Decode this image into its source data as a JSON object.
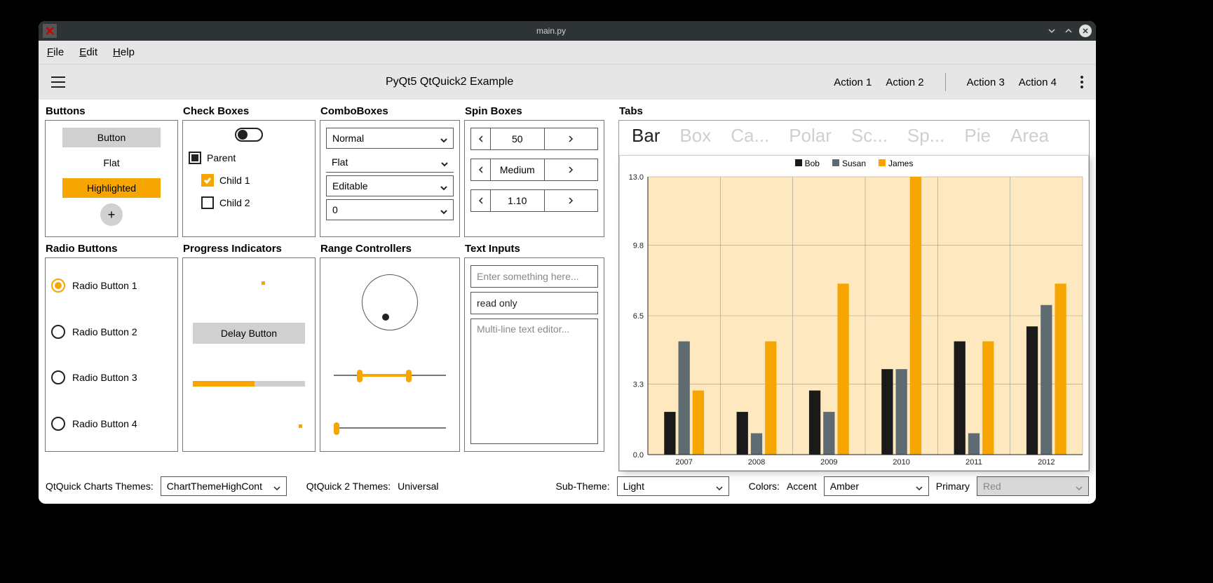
{
  "window": {
    "title": "main.py"
  },
  "menubar": {
    "file": "File",
    "edit": "Edit",
    "help": "Help"
  },
  "toolbar": {
    "app_title": "PyQt5 QtQuick2 Example",
    "action1": "Action 1",
    "action2": "Action 2",
    "action3": "Action 3",
    "action4": "Action 4"
  },
  "sections": {
    "buttons": "Buttons",
    "checkboxes": "Check Boxes",
    "combos": "ComboBoxes",
    "spins": "Spin Boxes",
    "tabs": "Tabs",
    "radios": "Radio Buttons",
    "progress": "Progress Indicators",
    "range": "Range Controllers",
    "text": "Text Inputs"
  },
  "buttons": {
    "button": "Button",
    "flat": "Flat",
    "highlighted": "Highlighted",
    "plus": "+"
  },
  "checkboxes": {
    "parent": "Parent",
    "child1": "Child 1",
    "child2": "Child 2"
  },
  "combos": {
    "normal": "Normal",
    "flat": "Flat",
    "editable": "Editable",
    "zero": "0"
  },
  "spins": {
    "s1": "50",
    "s2": "Medium",
    "s3": "1.10"
  },
  "radios": {
    "r1": "Radio Button 1",
    "r2": "Radio Button 2",
    "r3": "Radio Button 3",
    "r4": "Radio Button 4"
  },
  "progress": {
    "delay": "Delay Button"
  },
  "text_inputs": {
    "placeholder": "Enter something here...",
    "readonly": "read only",
    "multiline": "Multi-line text editor..."
  },
  "tabs": {
    "items": [
      "Bar",
      "Box",
      "Ca...",
      "Polar",
      "Sc...",
      "Sp...",
      "Pie",
      "Area"
    ],
    "active": 0
  },
  "chart_data": {
    "type": "bar",
    "title": "",
    "xlabel": "",
    "ylabel": "",
    "categories": [
      "2007",
      "2008",
      "2009",
      "2010",
      "2011",
      "2012"
    ],
    "series": [
      {
        "name": "Bob",
        "color": "#1a1a1a",
        "values": [
          2.0,
          2.0,
          3.0,
          4.0,
          5.3,
          6.0
        ]
      },
      {
        "name": "Susan",
        "color": "#5f6b73",
        "values": [
          5.3,
          1.0,
          2.0,
          4.0,
          1.0,
          7.0
        ]
      },
      {
        "name": "James",
        "color": "#f7a500",
        "values": [
          3.0,
          5.3,
          8.0,
          13.0,
          5.3,
          8.0
        ]
      }
    ],
    "ylim": [
      0,
      13
    ],
    "yticks": [
      0.0,
      3.3,
      6.5,
      9.8,
      13.0
    ],
    "grid": true,
    "band_color": "#fde8c0"
  },
  "bottom": {
    "charts_label": "QtQuick Charts Themes:",
    "charts_value": "ChartThemeHighCont",
    "themes_label": "QtQuick 2 Themes:",
    "themes_value": "Universal",
    "sub_label": "Sub-Theme:",
    "sub_value": "Light",
    "colors_label": "Colors:",
    "accent_label": "Accent",
    "accent_value": "Amber",
    "primary_label": "Primary",
    "primary_value": "Red"
  }
}
